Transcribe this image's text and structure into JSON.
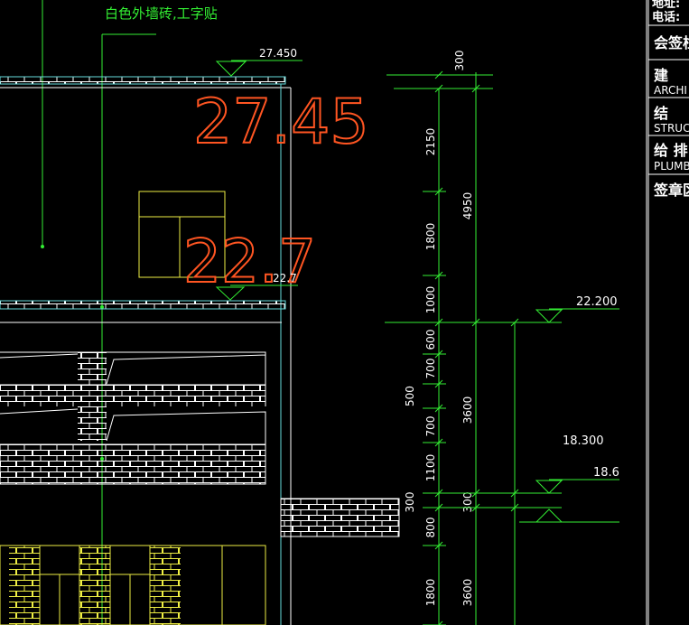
{
  "colors": {
    "background": "#000000",
    "line": "#ffffff",
    "dimension": "#33ee33",
    "leader": "#66dddd",
    "window": "#eeee44",
    "highlight": "#ff5522"
  },
  "leader_label": "白色外墙砖,工字贴",
  "elevations": {
    "top": "27.450",
    "top_big": "27.45",
    "mid_big": "22.7",
    "mid_small": "22.7",
    "right_upper": "22.200",
    "right_mid": "18.300",
    "right_lower": "18.6"
  },
  "dims_vertical_1": [
    "300",
    "2150",
    "1800",
    "1000",
    "600",
    "700",
    "700",
    "1100",
    "300",
    "800",
    "1800"
  ],
  "dims_vertical_2": [
    "4950",
    "3600",
    "300",
    "3600"
  ],
  "dim_left": "500",
  "title_block": {
    "addr": "地址:",
    "phone": "电话:",
    "countersign": "会签栏",
    "arch_cn": "建",
    "arch_en": "ARCHI",
    "struct_cn": "结",
    "struct_en": "STRUC",
    "plumb_cn": "给 排",
    "plumb_en": "PLUMB",
    "seal": "签章区"
  }
}
